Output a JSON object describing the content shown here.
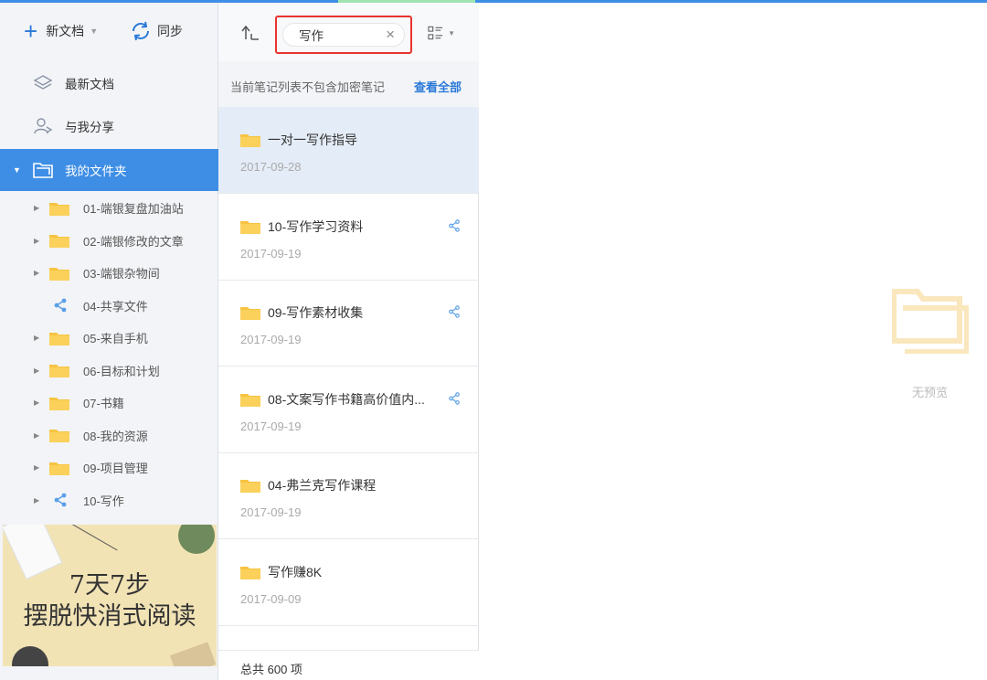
{
  "toolbar": {
    "new_doc": "新文档",
    "sync": "同步"
  },
  "nav": {
    "recent": "最新文档",
    "shared": "与我分享",
    "my_folders": "我的文件夹"
  },
  "tree": [
    {
      "label": "01-端银复盘加油站",
      "icon": "folder-icon"
    },
    {
      "label": "02-端银修改的文章",
      "icon": "folder-icon"
    },
    {
      "label": "03-端银杂物间",
      "icon": "folder-icon"
    },
    {
      "label": "04-共享文件",
      "icon": "share-icon"
    },
    {
      "label": "05-来自手机",
      "icon": "folder-icon"
    },
    {
      "label": "06-目标和计划",
      "icon": "folder-icon"
    },
    {
      "label": "07-书籍",
      "icon": "folder-icon"
    },
    {
      "label": "08-我的资源",
      "icon": "folder-icon"
    },
    {
      "label": "09-项目管理",
      "icon": "folder-icon"
    },
    {
      "label": "10-写作",
      "icon": "share-icon"
    }
  ],
  "banner": {
    "line1": "7天7步",
    "line2": "摆脱快消式阅读"
  },
  "search": {
    "value": "写作",
    "clear": "×"
  },
  "notice": {
    "text": "当前笔记列表不包含加密笔记",
    "link": "查看全部"
  },
  "notes": [
    {
      "title": "一对一写作指导",
      "date": "2017-09-28",
      "shared": false,
      "selected": true
    },
    {
      "title": "10-写作学习资料",
      "date": "2017-09-19",
      "shared": true,
      "selected": false
    },
    {
      "title": "09-写作素材收集",
      "date": "2017-09-19",
      "shared": true,
      "selected": false
    },
    {
      "title": "08-文案写作书籍高价值内...",
      "date": "2017-09-19",
      "shared": true,
      "selected": false
    },
    {
      "title": "04-弗兰克写作课程",
      "date": "2017-09-19",
      "shared": false,
      "selected": false
    },
    {
      "title": "写作赚8K",
      "date": "2017-09-09",
      "shared": false,
      "selected": false
    }
  ],
  "footer": {
    "total": "总共 600 项"
  },
  "preview": {
    "empty_text": "无预览"
  },
  "colors": {
    "accent": "#3e8ee6",
    "folder": "#f7c341",
    "highlight_box": "#e8342e"
  }
}
